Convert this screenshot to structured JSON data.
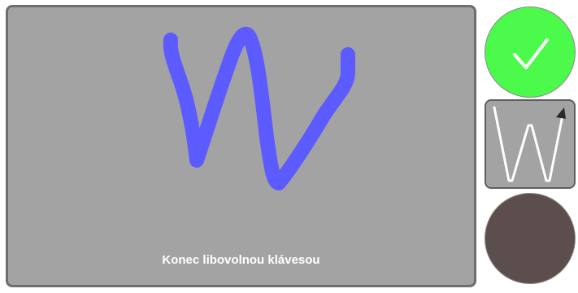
{
  "canvas": {
    "hint": "Konec libovolnou klávesou",
    "stroke_color": "#5b5bff",
    "background_color": "#a3a3a3"
  },
  "sidebar": {
    "confirm": {
      "icon": "checkmark-icon",
      "color": "#4cfa4c"
    },
    "template": {
      "icon": "letter-w-template-icon",
      "letter": "W"
    },
    "pen_color": {
      "color": "#5d4e4e"
    }
  }
}
